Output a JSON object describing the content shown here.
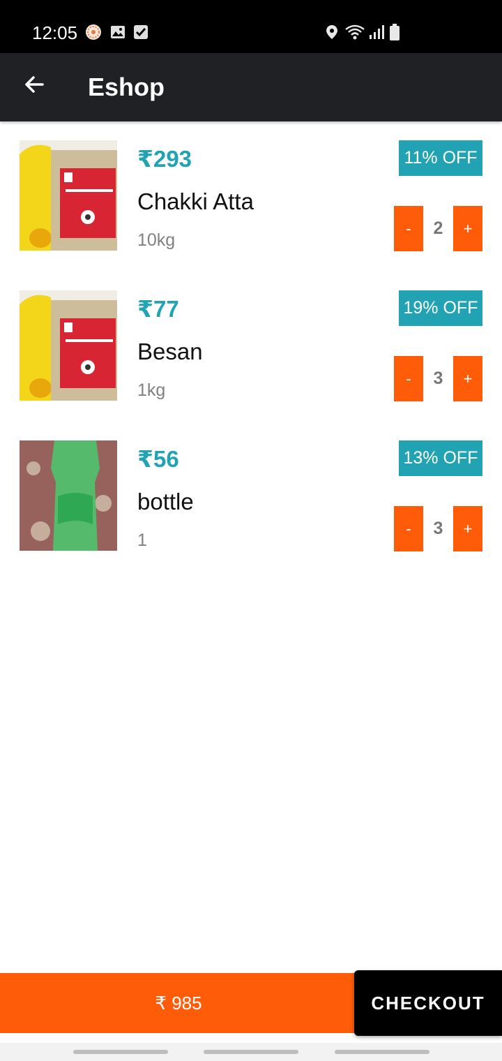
{
  "status_bar": {
    "time": "12:05",
    "left_icons": [
      "app-badge-icon",
      "image-icon",
      "checkbox-icon"
    ],
    "right_icons": [
      "location-icon",
      "wifi-icon",
      "signal-icon",
      "battery-icon"
    ]
  },
  "app_bar": {
    "back_icon": "arrow-left-icon",
    "title": "Eshop"
  },
  "cart": {
    "items": [
      {
        "price": "₹293",
        "name": "Chakki Atta",
        "unit": "10kg",
        "discount": "11% OFF",
        "minus": "-",
        "quantity": "2",
        "plus": "+"
      },
      {
        "price": "₹77",
        "name": "Besan",
        "unit": "1kg",
        "discount": "19% OFF",
        "minus": "-",
        "quantity": "3",
        "plus": "+"
      },
      {
        "price": "₹56",
        "name": "bottle",
        "unit": "1",
        "discount": "13% OFF",
        "minus": "-",
        "quantity": "3",
        "plus": "+"
      }
    ]
  },
  "footer": {
    "total": "₹ 985",
    "checkout_label": "CHECKOUT"
  },
  "colors": {
    "accent_teal": "#21a3b4",
    "accent_orange": "#ff5c0a",
    "app_bar": "#1f2124"
  }
}
